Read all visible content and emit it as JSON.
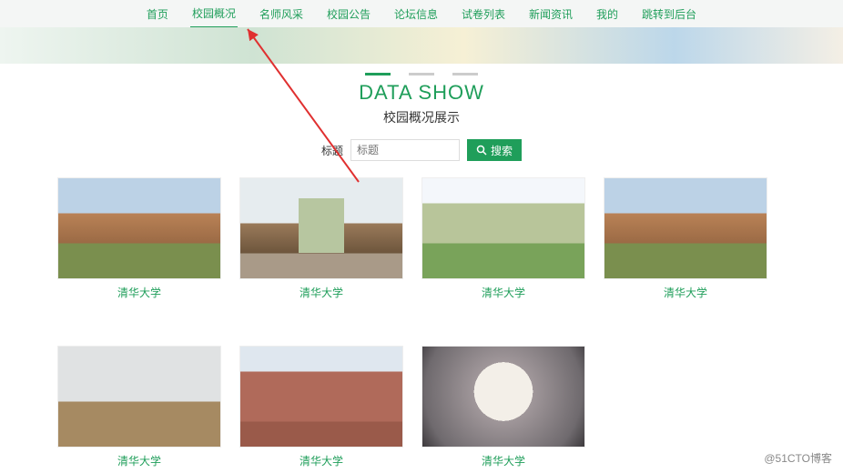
{
  "nav": {
    "items": [
      {
        "label": "首页",
        "active": false
      },
      {
        "label": "校园概况",
        "active": true
      },
      {
        "label": "名师风采",
        "active": false
      },
      {
        "label": "校园公告",
        "active": false
      },
      {
        "label": "论坛信息",
        "active": false
      },
      {
        "label": "试卷列表",
        "active": false
      },
      {
        "label": "新闻资讯",
        "active": false
      },
      {
        "label": "我的",
        "active": false
      },
      {
        "label": "跳转到后台",
        "active": false
      }
    ]
  },
  "header": {
    "title_en": "DATA SHOW",
    "title_cn": "校园概况展示"
  },
  "search": {
    "label": "标题",
    "placeholder": "标题",
    "button": "搜索"
  },
  "cards": [
    {
      "caption": "清华大学"
    },
    {
      "caption": "清华大学"
    },
    {
      "caption": "清华大学"
    },
    {
      "caption": "清华大学"
    },
    {
      "caption": "清华大学"
    },
    {
      "caption": "清华大学"
    },
    {
      "caption": "清华大学"
    }
  ],
  "watermark": "@51CTO博客"
}
